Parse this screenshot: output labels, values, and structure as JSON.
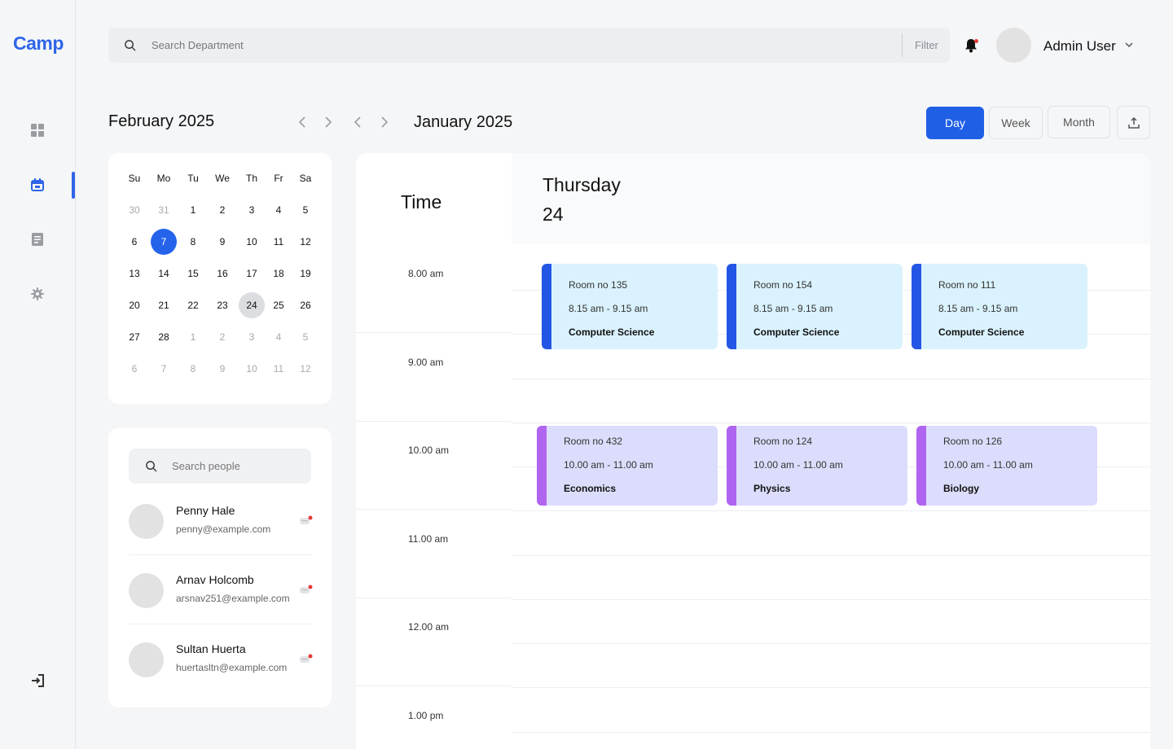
{
  "app": {
    "logo": "Camp"
  },
  "sidebar": {
    "items": [
      {
        "name": "dashboard",
        "icon": "grid-icon",
        "active": false
      },
      {
        "name": "calendar",
        "icon": "calendar-icon",
        "active": true
      },
      {
        "name": "reports",
        "icon": "document-icon",
        "active": false
      },
      {
        "name": "settings",
        "icon": "gear-icon",
        "active": false
      }
    ],
    "logout_icon": "logout-icon"
  },
  "header": {
    "search_placeholder": "Search Department",
    "filter_label": "Filter",
    "user_name": "Admin User",
    "has_notification": true
  },
  "mini_calendar": {
    "title": "February 2025",
    "weekdays": [
      "Su",
      "Mo",
      "Tu",
      "We",
      "Th",
      "Fr",
      "Sa"
    ],
    "weeks": [
      [
        "30",
        "31",
        "1",
        "2",
        "3",
        "4",
        "5"
      ],
      [
        "6",
        "7",
        "8",
        "9",
        "10",
        "11",
        "12"
      ],
      [
        "13",
        "14",
        "15",
        "16",
        "17",
        "18",
        "19"
      ],
      [
        "20",
        "21",
        "22",
        "23",
        "24",
        "25",
        "26"
      ],
      [
        "27",
        "28",
        "1",
        "2",
        "3",
        "4",
        "5"
      ],
      [
        "6",
        "7",
        "8",
        "9",
        "10",
        "11",
        "12"
      ]
    ],
    "selected_day": "7",
    "highlighted_day": "24"
  },
  "people": {
    "search_placeholder": "Search people",
    "list": [
      {
        "name": "Penny Hale",
        "email": "penny@example.com"
      },
      {
        "name": "Arnav Holcomb",
        "email": "arsnav251@example.com"
      },
      {
        "name": "Sultan Huerta",
        "email": "huertasltn@example.com"
      }
    ]
  },
  "schedule": {
    "month_title": "January 2025",
    "views": [
      "Day",
      "Week",
      "Month"
    ],
    "active_view": "Day",
    "time_header": "Time",
    "day_name": "Thursday",
    "day_number": "24",
    "times": [
      "8.00 am",
      "9.00 am",
      "10.00 am",
      "11.00 am",
      "12.00 am",
      "1.00 pm"
    ],
    "events": [
      {
        "room": "Room no 135",
        "time": "8.15 am - 9.15 am",
        "dept": "Computer Science",
        "color": "blue"
      },
      {
        "room": "Room no 154",
        "time": "8.15 am - 9.15 am",
        "dept": "Computer Science",
        "color": "blue"
      },
      {
        "room": "Room no 111",
        "time": "8.15 am - 9.15 am",
        "dept": "Computer Science",
        "color": "blue"
      },
      {
        "room": "Room no 432",
        "time": "10.00 am - 11.00 am",
        "dept": "Economics",
        "color": "purple"
      },
      {
        "room": "Room no 124",
        "time": "10.00 am - 11.00 am",
        "dept": "Physics",
        "color": "purple"
      },
      {
        "room": "Room no 126",
        "time": "10.00 am - 11.00 am",
        "dept": "Biology",
        "color": "purple"
      }
    ]
  },
  "colors": {
    "accent": "#2f66e8",
    "event_blue_bg": "#daf2fd",
    "event_blue_bar": "#2456e6",
    "event_purple_bg": "#dcdcfc",
    "event_purple_bar": "#b065f0",
    "notification_dot": "#e53935"
  }
}
